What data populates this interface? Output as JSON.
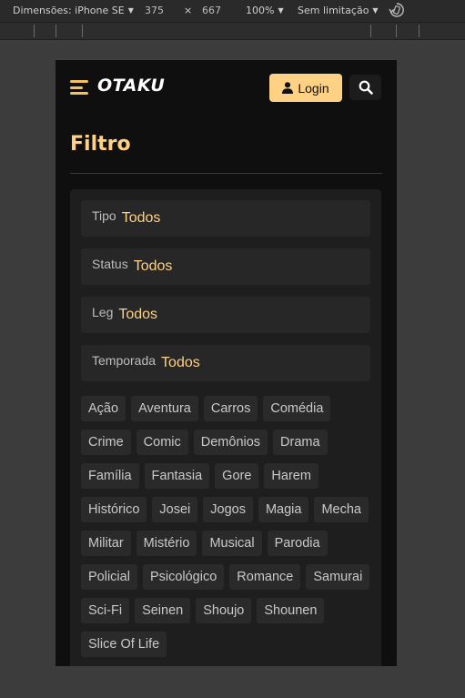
{
  "devtools": {
    "device_label": "Dimensões: iPhone SE",
    "width": "375",
    "times": "×",
    "height": "667",
    "zoom": "100%",
    "throttle": "Sem limitação"
  },
  "header": {
    "brand": "OTAKU",
    "login_label": "Login"
  },
  "page": {
    "title": "Filtro"
  },
  "filters": [
    {
      "label": "Tipo",
      "value": "Todos"
    },
    {
      "label": "Status",
      "value": "Todos"
    },
    {
      "label": "Leg",
      "value": "Todos"
    },
    {
      "label": "Temporada",
      "value": "Todos"
    }
  ],
  "genres": [
    "Ação",
    "Aventura",
    "Carros",
    "Comédia",
    "Crime",
    "Comic",
    "Demônios",
    "Drama",
    "Família",
    "Fantasia",
    "Gore",
    "Harem",
    "Histórico",
    "Josei",
    "Jogos",
    "Magia",
    "Mecha",
    "Militar",
    "Mistério",
    "Musical",
    "Parodia",
    "Policial",
    "Psicológico",
    "Romance",
    "Samurai",
    "Sci-Fi",
    "Seinen",
    "Shoujo",
    "Shounen",
    "Slice Of Life"
  ],
  "colors": {
    "accent": "#ffd184",
    "background": "#0f0f0f",
    "panel": "#1e1e1e"
  }
}
